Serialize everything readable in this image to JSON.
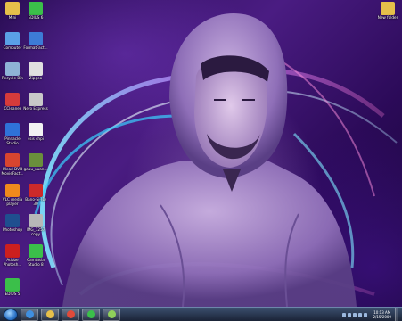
{
  "desktop": {
    "icons": [
      {
        "label": "Mini",
        "icon": "folder-icon",
        "color": "#e6c04a"
      },
      {
        "label": "EDIUS 6",
        "icon": "edius-icon",
        "color": "#3bbf4a"
      },
      {
        "label": "Computer",
        "icon": "computer-icon",
        "color": "#5aa0e6"
      },
      {
        "label": "FormatFact...",
        "icon": "format-factory-icon",
        "color": "#3d7bd6"
      },
      {
        "label": "Recycle Bin",
        "icon": "recycle-bin-icon",
        "color": "#8fb3d6"
      },
      {
        "label": "Zipgeo",
        "icon": "zipgeo-icon",
        "color": "#e0e0e0"
      },
      {
        "label": "CCleaner",
        "icon": "ccleaner-icon",
        "color": "#d63b3b"
      },
      {
        "label": "Nero Express",
        "icon": "nero-icon",
        "color": "#c9c9c9"
      },
      {
        "label": "Pinnacle Studio",
        "icon": "pinnacle-icon",
        "color": "#2f72d8"
      },
      {
        "label": "ssis chpi",
        "icon": "file-icon",
        "color": "#f2f2f2"
      },
      {
        "label": "Ulead DVD MovieFact...",
        "icon": "ulead-icon",
        "color": "#d8452f"
      },
      {
        "label": "gaau_xuan...",
        "icon": "image-file-icon",
        "color": "#6a8f3c"
      },
      {
        "label": "VLC media player",
        "icon": "vlc-icon",
        "color": "#f08a1c"
      },
      {
        "label": "Bano-Si-(1) 30",
        "icon": "media-file-icon",
        "color": "#cc2a2a"
      },
      {
        "label": "Photoshop",
        "icon": "photoshop-icon",
        "color": "#1f4f8f"
      },
      {
        "label": "IMG_1257 copy",
        "icon": "image-file-icon",
        "color": "#b8b8b8"
      },
      {
        "label": "Adobe Photosh...",
        "icon": "adobe-icon",
        "color": "#cc1f1f"
      },
      {
        "label": "Camtasia Studio 8",
        "icon": "camtasia-icon",
        "color": "#3bbf4a"
      },
      {
        "label": "EDIUS 5",
        "icon": "edius-icon",
        "color": "#3bbf4a"
      },
      {
        "label": "New folder",
        "icon": "folder-icon",
        "color": "#e6c04a"
      }
    ]
  },
  "taskbar": {
    "pinned": [
      {
        "name": "ie-icon",
        "color": "#3f8fe0"
      },
      {
        "name": "explorer-icon",
        "color": "#e6c04a"
      },
      {
        "name": "chrome-icon",
        "color": "#e04a3a"
      },
      {
        "name": "camtasia-icon",
        "color": "#3bbf4a"
      },
      {
        "name": "camtasia-recorder-icon",
        "color": "#8fd05a"
      }
    ],
    "clock": {
      "time": "10:13 AM",
      "date": "2/15/2009"
    }
  },
  "colors": {
    "taskbar": "#26344d",
    "accent": "#7a3fd0"
  }
}
